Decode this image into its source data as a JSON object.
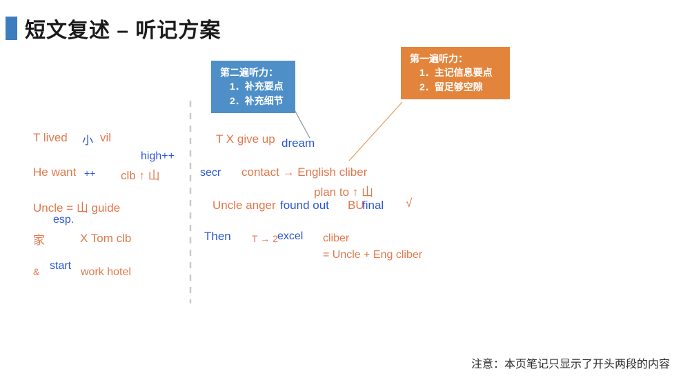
{
  "slide": {
    "title": "短文复述 – 听记方案",
    "accent_color": "#3C7DBF",
    "footer_note": "注意：本页笔记只显示了开头两段的内容"
  },
  "callouts": {
    "second_listening": {
      "heading": "第二遍听力：",
      "items": [
        "1．补充要点",
        "2．补充细节"
      ],
      "color": "#4E8FC8"
    },
    "first_listening": {
      "heading": "第一遍听力：",
      "items": [
        "1．主记信息要点",
        "2．留足够空隙"
      ],
      "color": "#E3843C"
    }
  },
  "notes": {
    "orange_color": "#E2774B",
    "blue_color": "#2A56D6",
    "left_column": {
      "l1_a": "T  lived",
      "l1_b": "小",
      "l1_c": "vil",
      "l2_super": "high++",
      "l2_a": "He want",
      "l2_b": "++",
      "l2_c": "clb ↑ 山",
      "l3_a": "Uncle = 山 guide",
      "l3_b": "esp.",
      "l4_a": "家",
      "l4_b": "X Tom clb",
      "l5_a": "&",
      "l5_b": "start",
      "l5_c": "work hotel"
    },
    "right_column": {
      "r1_a": "T X give up",
      "r1_b": "dream",
      "r2_a": "secr",
      "r2_b": "contact → English cliber",
      "r3_a": "plan to ↑ 山",
      "r4_a": "Uncle anger",
      "r4_b": "found out",
      "r4_c": "BU",
      "r4_d": "final",
      "r4_e": "√",
      "r5_a": "Then",
      "r5_b": "T → 2",
      "r5_c": "excel",
      "r5_d": "cliber",
      "r6_a": "= Uncle + Eng cliber"
    }
  }
}
